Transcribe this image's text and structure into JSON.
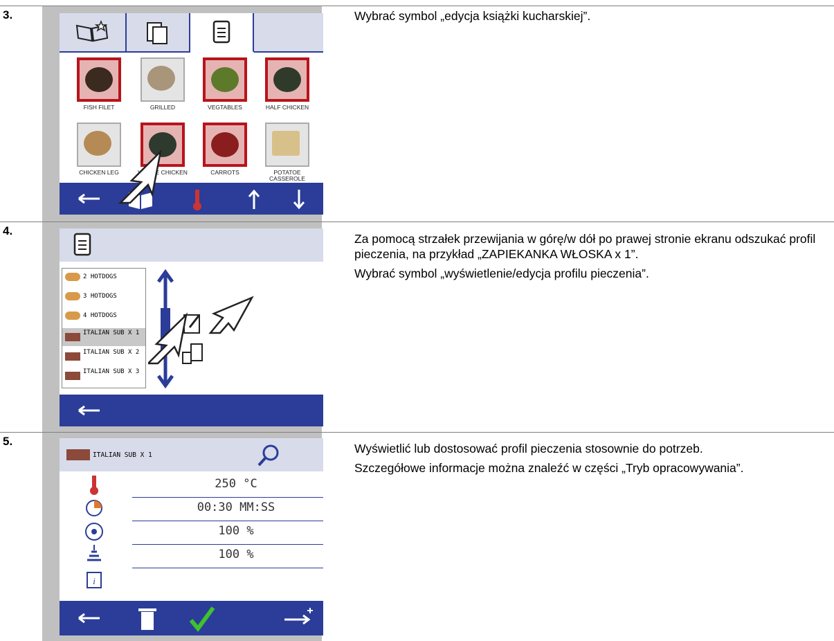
{
  "steps": [
    {
      "number": "3.",
      "instructions": [
        "Wybrać symbol „edycja książki kucharskiej”."
      ],
      "screen": {
        "tabs": [
          "cookbook-star-icon",
          "copy-pages-icon",
          "notepad-icon"
        ],
        "items": [
          {
            "label": "FISH FILET",
            "selected": true
          },
          {
            "label": "GRILLED",
            "selected": false
          },
          {
            "label": "VEGTABLES",
            "selected": true
          },
          {
            "label": "HALF CHICKEN",
            "selected": true
          },
          {
            "label": "CHICKEN LEG",
            "selected": false
          },
          {
            "label": "WHOLE CHICKEN",
            "selected": true
          },
          {
            "label": "CARROTS",
            "selected": true
          },
          {
            "label": "POTATOE CASSEROLE",
            "selected": false
          }
        ],
        "bottom_icons": [
          "back-arrow-icon",
          "book-edit-icon",
          "thermometer-icon",
          "arrow-up-icon",
          "arrow-down-icon"
        ]
      }
    },
    {
      "number": "4.",
      "instructions": [
        "Za pomocą strzałek przewijania w górę/w dół po prawej stronie ekranu odszukać profil pieczenia, na przykład „ZAPIEKANKA WŁOSKA x 1”.",
        "Wybrać symbol „wyświetlenie/edycja profilu pieczenia”."
      ],
      "screen": {
        "list": [
          {
            "label": "2 HOTDOGS",
            "selected": false
          },
          {
            "label": "3 HOTDOGS",
            "selected": false
          },
          {
            "label": "4 HOTDOGS",
            "selected": false
          },
          {
            "label": "ITALIAN SUB X 1",
            "selected": true
          },
          {
            "label": "ITALIAN SUB X 2",
            "selected": false
          },
          {
            "label": "ITALIAN SUB X 3",
            "selected": false
          }
        ]
      }
    },
    {
      "number": "5.",
      "instructions": [
        "Wyświetlić lub dostosować profil pieczenia stosownie do potrzeb.",
        "Szczegółowe informacje można znaleźć w części „Tryb opracowywania”."
      ],
      "screen": {
        "title": "ITALIAN SUB X 1",
        "rows": [
          {
            "icon": "thermometer-icon",
            "value": "250 °C"
          },
          {
            "icon": "timer-icon",
            "value": "00:30 MM:SS"
          },
          {
            "icon": "fan-icon",
            "value": "100 %"
          },
          {
            "icon": "steam-icon",
            "value": "100 %"
          },
          {
            "icon": "info-icon",
            "value": ""
          }
        ]
      }
    }
  ],
  "colors": {
    "bar_blue": "#2b3d98",
    "header_lavender": "#d7dbea",
    "frame_gray": "#c0c0c0",
    "select_red": "#b8141b"
  }
}
